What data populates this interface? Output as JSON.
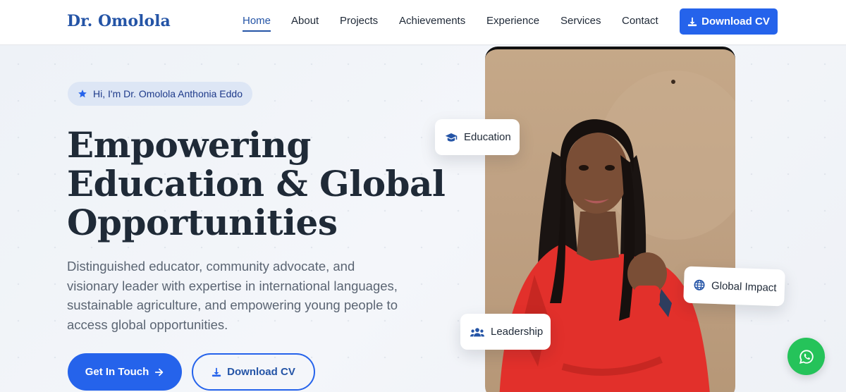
{
  "nav": {
    "brand": "Dr. Omolola",
    "links": [
      "Home",
      "About",
      "Projects",
      "Achievements",
      "Experience",
      "Services",
      "Contact"
    ],
    "active": "Home",
    "cta_label": "Download CV"
  },
  "hero": {
    "badge": "Hi, I'm Dr. Omolola Anthonia Eddo",
    "headline_lines": [
      "Empowering",
      "Education & Global",
      "Opportunities"
    ],
    "description": "Distinguished educator, community advocate, and visionary leader with expertise in international languages, sustainable agriculture, and empowering young people to access global opportunities.",
    "primary_button": "Get In Touch",
    "secondary_button": "Download CV"
  },
  "floating_cards": {
    "education": "Education",
    "global_impact": "Global Impact",
    "leadership": "Leadership"
  },
  "colors": {
    "brand": "#2454a6",
    "accent": "#2563eb",
    "whatsapp": "#25c35a"
  },
  "icons": {
    "badge": "star-icon",
    "cta": "download-icon",
    "primary_button": "arrow-right-icon",
    "education": "graduation-cap-icon",
    "global_impact": "globe-icon",
    "leadership": "users-icon",
    "floating_button": "whatsapp-icon"
  }
}
